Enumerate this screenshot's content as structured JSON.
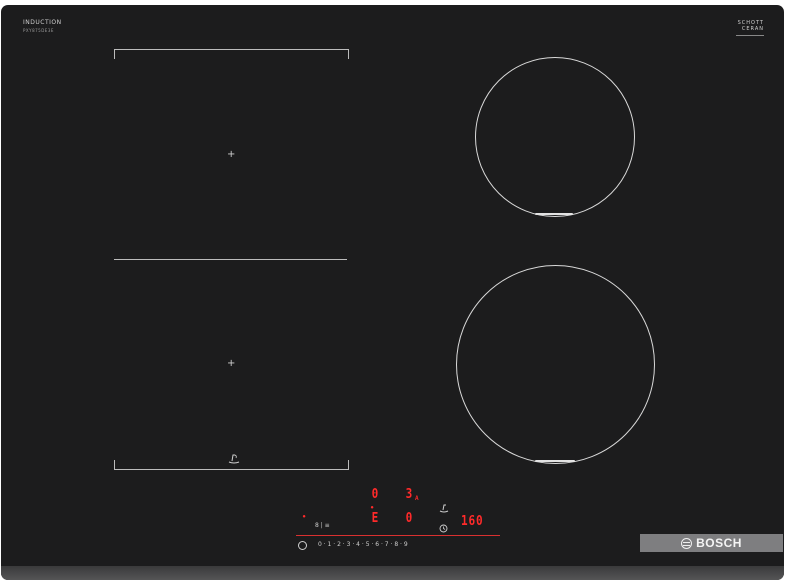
{
  "brand": {
    "top_left": "INDUCTION",
    "top_left_sub": "PXY875DE3E",
    "top_right_line1": "SCHOTT",
    "top_right_line2": "CERAN",
    "plate": "BOSCH"
  },
  "flex_zone": {
    "top_cross": "+",
    "bottom_cross": "+"
  },
  "displays": {
    "left_top": "0",
    "left_bottom": "E",
    "right_top": "3",
    "right_top_sub": "A",
    "right_bottom": "0",
    "timer": "160",
    "left_marker": "•",
    "fry_marker": "•"
  },
  "control_panel": {
    "left_icons": "8 | ≡",
    "power_scale": "0 · 1 · 2 · 3 · 4 · 5 · 6 · 7 · 8 · 9",
    "accent_color": "#ff2a2a"
  }
}
